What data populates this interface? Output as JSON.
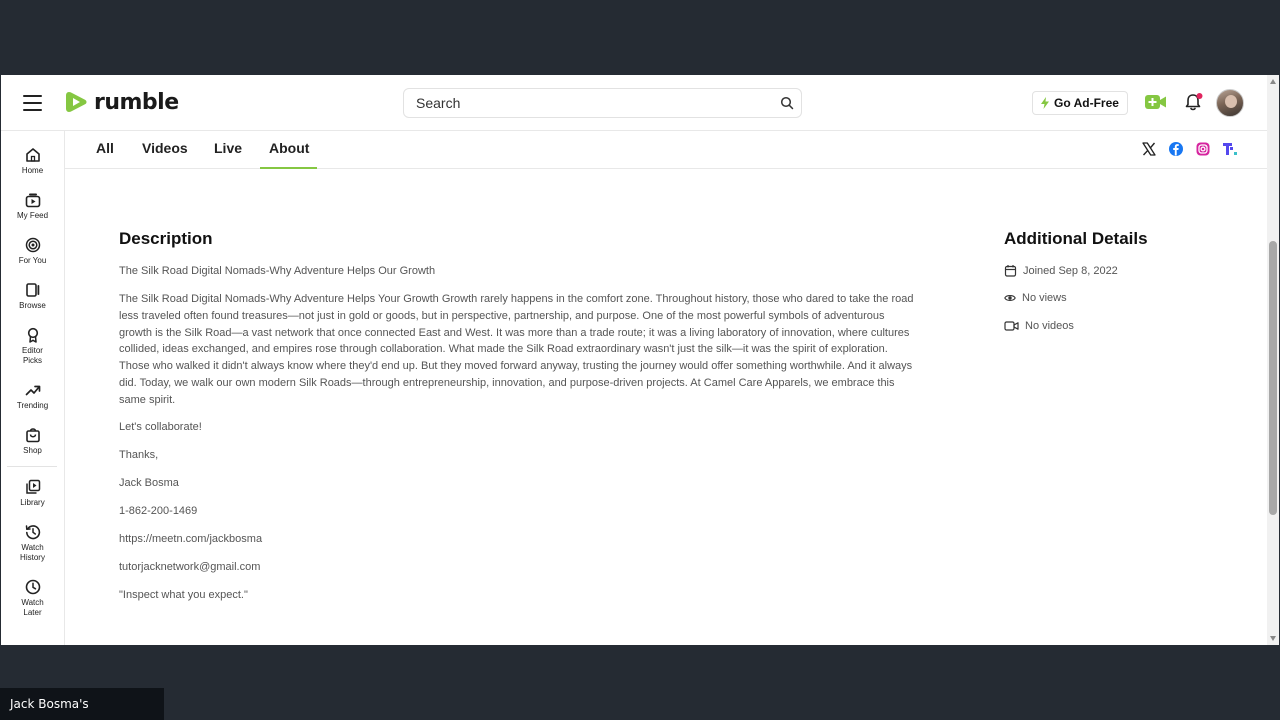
{
  "header": {
    "logo_text": "rumble",
    "search_placeholder": "Search",
    "ad_free_label": "Go Ad-Free"
  },
  "sidebar": {
    "items": [
      {
        "label": "Home",
        "icon": "home-icon"
      },
      {
        "label": "My Feed",
        "icon": "feed-icon"
      },
      {
        "label": "For You",
        "icon": "target-icon"
      },
      {
        "label": "Browse",
        "icon": "browse-icon"
      },
      {
        "label": "Editor Picks",
        "icon": "award-icon"
      },
      {
        "label": "Trending",
        "icon": "trending-icon"
      },
      {
        "label": "Shop",
        "icon": "shop-icon"
      },
      {
        "label": "Library",
        "icon": "library-icon"
      },
      {
        "label": "Watch History",
        "icon": "history-icon"
      },
      {
        "label": "Watch Later",
        "icon": "clock-icon"
      }
    ]
  },
  "tabs": [
    "All",
    "Videos",
    "Live",
    "About"
  ],
  "active_tab": "About",
  "description": {
    "title": "Description",
    "subtitle": "The Silk Road Digital Nomads-Why Adventure Helps Our Growth",
    "body": "The Silk Road Digital Nomads-Why Adventure Helps Your Growth Growth rarely happens in the comfort zone. Throughout history, those who dared to take the road less traveled often found treasures—not just in gold or goods, but in perspective, partnership, and purpose. One of the most powerful symbols of adventurous growth is the Silk Road—a vast network that once connected East and West. It was more than a trade route; it was a living laboratory of innovation, where cultures collided, ideas exchanged, and empires rose through collaboration. What made the Silk Road extraordinary wasn't just the silk—it was the spirit of exploration. Those who walked it didn't always know where they'd end up. But they moved forward anyway, trusting the journey would offer something worthwhile. And it always did. Today, we walk our own modern Silk Roads—through entrepreneurship, innovation, and purpose-driven projects. At Camel Care Apparels, we embrace this same spirit.",
    "collab": "Let's collaborate!",
    "thanks": "Thanks,",
    "name": "Jack Bosma",
    "phone": "1-862-200-1469",
    "url": "https://meetn.com/jackbosma",
    "email": "tutorjacknetwork@gmail.com",
    "quote": "\"Inspect what you expect.\""
  },
  "details": {
    "title": "Additional Details",
    "joined": "Joined Sep 8, 2022",
    "views": "No views",
    "videos": "No videos"
  },
  "caption": "Jack Bosma's Presentation",
  "colors": {
    "accent": "#85c742",
    "background": "#252b33",
    "facebook": "#1877f2",
    "instagram": "#d6249f",
    "truth": "#5448ee",
    "notify_dot": "#e0245e"
  }
}
